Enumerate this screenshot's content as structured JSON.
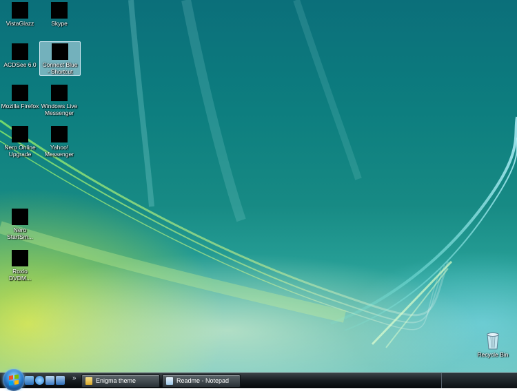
{
  "desktop": {
    "icons": [
      {
        "label": "VistaGlazz",
        "selected": false
      },
      {
        "label": "Skype",
        "selected": false
      },
      {
        "label": "ACDSee 6.0",
        "selected": false
      },
      {
        "label": "Connect Blue - Shortcut",
        "selected": true
      },
      {
        "label": "Mozilla Firefox",
        "selected": false
      },
      {
        "label": "Windows Live Messenger",
        "selected": false
      },
      {
        "label": "Nero Online Upgrade",
        "selected": false
      },
      {
        "label": "Yahoo! Messenger",
        "selected": false
      },
      {
        "label": "Nero StartSm...",
        "selected": false
      },
      {
        "label": "Roxio DVDM...",
        "selected": false
      }
    ],
    "recycle_bin": {
      "label": "Recycle Bin",
      "icon": "recycle-bin-icon"
    }
  },
  "taskbar": {
    "start_icon": "windows-start-orb",
    "quick_launch": [
      {
        "icon": "show-desktop-icon",
        "color": "#4a8fd6"
      },
      {
        "icon": "internet-explorer-icon",
        "color": "#2e84d8"
      },
      {
        "icon": "switch-windows-icon",
        "color": "#3d7bc4"
      },
      {
        "icon": "media-player-icon",
        "color": "#2f6fb8"
      }
    ],
    "quick_launch_more": "»",
    "tasks": [
      {
        "label": "Enigma theme",
        "icon": "folder-icon",
        "icon_color": "#e8c24a"
      },
      {
        "label": "Readme - Notepad",
        "icon": "notepad-icon",
        "icon_color": "#9fc8e8"
      }
    ]
  }
}
